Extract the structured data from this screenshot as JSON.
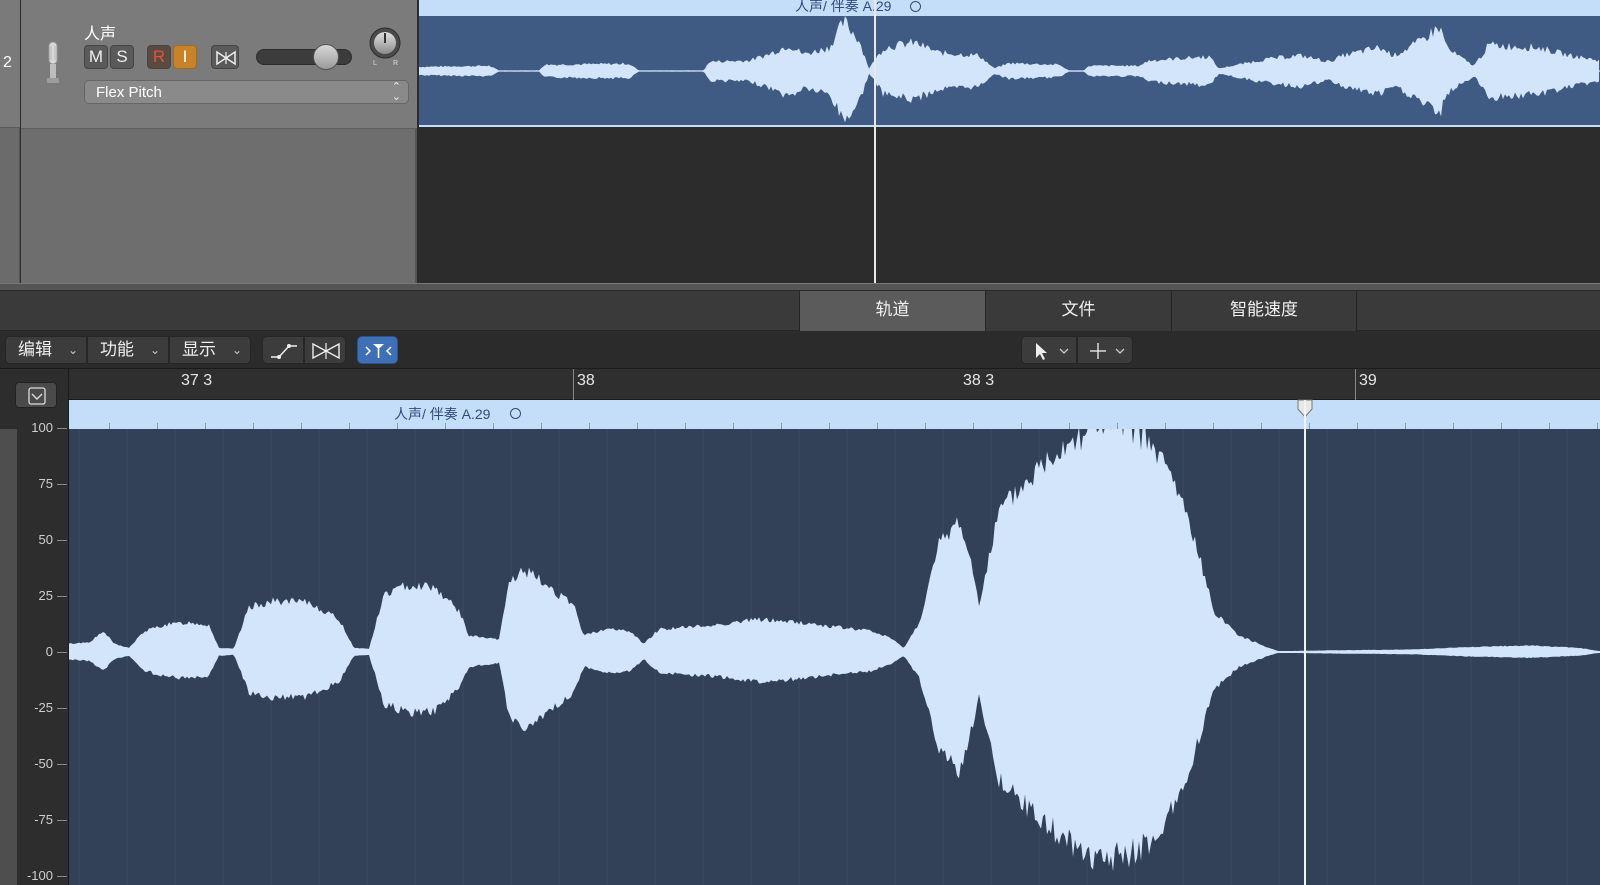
{
  "track": {
    "number": "2",
    "name": "人声",
    "buttons": {
      "mute": "M",
      "solo": "S",
      "record": "R",
      "input": "I"
    },
    "pan": {
      "left": "L",
      "right": "R"
    },
    "flex_mode": "Flex Pitch"
  },
  "region": {
    "name": "人声/ 伴奏 A.29"
  },
  "editor_tabs": [
    "轨道",
    "文件",
    "智能速度"
  ],
  "toolbar": {
    "edit": "编辑",
    "functions": "功能",
    "view": "显示"
  },
  "ruler": {
    "bars": [
      "37 3",
      "38",
      "38 3",
      "39"
    ]
  },
  "amplitude_scale": [
    "100",
    "75",
    "50",
    "25",
    "0",
    "-25",
    "-50",
    "-75",
    "-100"
  ],
  "icons": [
    "mic-icon",
    "freeze-icon",
    "curve-icon",
    "catch-icon",
    "flex-icon",
    "pointer-tool-icon",
    "marquee-tool-icon",
    "collapse-icon",
    "loop-icon",
    "playhead-icon"
  ],
  "colors": {
    "region_body": "#3f5b84",
    "region_header": "#c4ddf9",
    "waveform": "#d3e5fb",
    "editor_bg": "#334158",
    "flex_active": "#3f6fb5",
    "record": "#e2523f",
    "input": "#c8822a"
  }
}
